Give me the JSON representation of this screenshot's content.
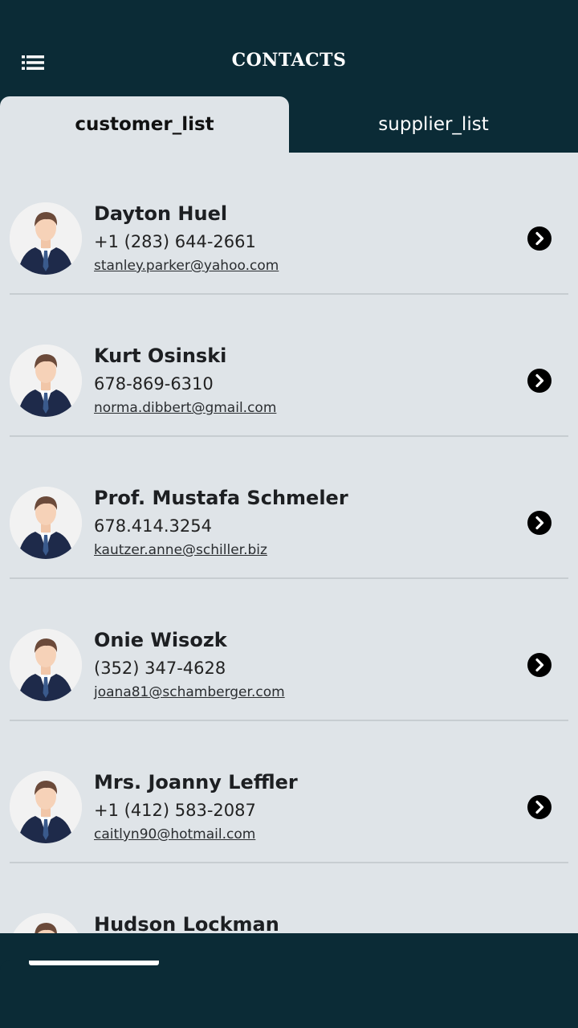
{
  "header": {
    "title": "CONTACTS",
    "menu_icon": "list-menu-icon"
  },
  "tabs": [
    {
      "label": "customer_list",
      "active": true
    },
    {
      "label": "supplier_list",
      "active": false
    }
  ],
  "contacts": [
    {
      "name": "Dayton Huel",
      "phone": "+1 (283) 644-2661",
      "email": "stanley.parker@yahoo.com"
    },
    {
      "name": "Kurt Osinski",
      "phone": "678-869-6310",
      "email": "norma.dibbert@gmail.com"
    },
    {
      "name": "Prof. Mustafa Schmeler",
      "phone": "678.414.3254",
      "email": "kautzer.anne@schiller.biz"
    },
    {
      "name": "Onie Wisozk",
      "phone": "(352) 347-4628",
      "email": "joana81@schamberger.com"
    },
    {
      "name": "Mrs. Joanny Leffler",
      "phone": "+1 (412) 583-2087",
      "email": "caitlyn90@hotmail.com"
    },
    {
      "name": "Hudson Lockman",
      "phone": "",
      "email": ""
    }
  ],
  "colors": {
    "header_bg": "#0b2b36",
    "content_bg": "#dfe4e8",
    "divider": "#c7cdd1",
    "suit": "#1e2a4a",
    "tie": "#3a5a8c"
  }
}
